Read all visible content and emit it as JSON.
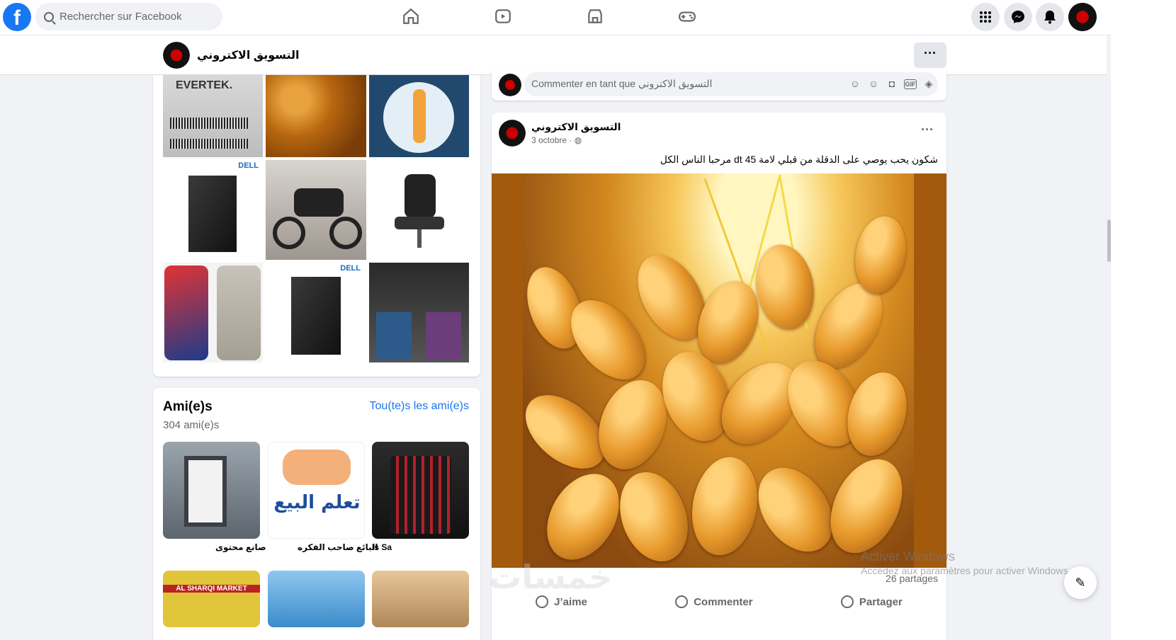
{
  "topbar": {
    "search_placeholder": "Rechercher sur Facebook",
    "logo_letter": "f"
  },
  "page": {
    "name": "التسويق الاكتروني",
    "more_label": "···"
  },
  "photos": {
    "tiles": [
      "EVERTEK.",
      "DELL",
      "DELL"
    ]
  },
  "friends": {
    "title": "Ami(e)s",
    "count": "304 ami(e)s",
    "see_all": "Tou(te)s les ami(e)s",
    "items": [
      {
        "name": "صانع محتوى"
      },
      {
        "name": "البائع صاحب الفكره"
      },
      {
        "name": "Is Sa"
      }
    ],
    "next_row": {
      "label": "AL SHARQI MARKET"
    },
    "learn_sell_text": "تعلم البيع"
  },
  "comment": {
    "placeholder": "Commenter en tant que التسويق الاكتروني"
  },
  "post": {
    "author": "التسويق الاكتروني",
    "date": "3 octobre · ",
    "text": "شكون يحب يوصي على الدقلة من قبلي  لامة 45 dt مرحبا الناس الكل",
    "shares": "26 partages",
    "actions": {
      "like": "J’aime",
      "comment": "Commenter",
      "share": "Partager"
    },
    "menu_dots": "···"
  },
  "overlay": {
    "activate_title": "Activer Windows",
    "activate_sub": "Accédez aux paramètres pour activer Windows.",
    "watermark": "خمسات"
  },
  "colors": {
    "accent": "#1877f2",
    "bg": "#f0f2f5"
  }
}
